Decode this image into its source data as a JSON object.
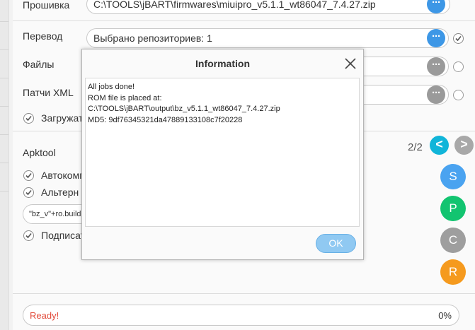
{
  "firmware": {
    "label": "Прошивка",
    "path": "C:\\TOOLS\\jBART\\firmwares\\miuipro_v5.1.1_wt86047_7.4.27.zip"
  },
  "translation": {
    "label": "Перевод",
    "value": "Выбрано репозиториев: 1"
  },
  "files": {
    "label": "Файлы"
  },
  "xml_patches": {
    "label": "Патчи XML"
  },
  "download_option": {
    "label": "Загружать"
  },
  "apktool": {
    "label": "Apktool",
    "page_indicator": "2/2",
    "prev_label": "<",
    "next_label": ">",
    "option_auto": "Автокомп",
    "option_alt": "Альтерн",
    "expression_value": "\"bz_v\"+ro.build",
    "option_sign": "Подписат"
  },
  "side_buttons": [
    {
      "label": "S",
      "color": "#4aa3f0"
    },
    {
      "label": "P",
      "color": "#12c470"
    },
    {
      "label": "C",
      "color": "#9e9e9e"
    },
    {
      "label": "R",
      "color": "#f59a1e"
    }
  ],
  "dots_label": "···",
  "status": {
    "text": "Ready!",
    "progress": "0%"
  },
  "dialog": {
    "title": "Information",
    "lines": [
      "All jobs done!",
      "ROM file is placed at:",
      "C:\\TOOLS\\jBART\\output\\bz_v5.1.1_wt86047_7.4.27.zip",
      "MD5: 9df76345321da47889133108c7f20228"
    ],
    "ok_label": "OK"
  },
  "colors": {
    "accent": "#3d97e6",
    "cyan": "#11b5d9",
    "status_red": "#e24a3a"
  }
}
